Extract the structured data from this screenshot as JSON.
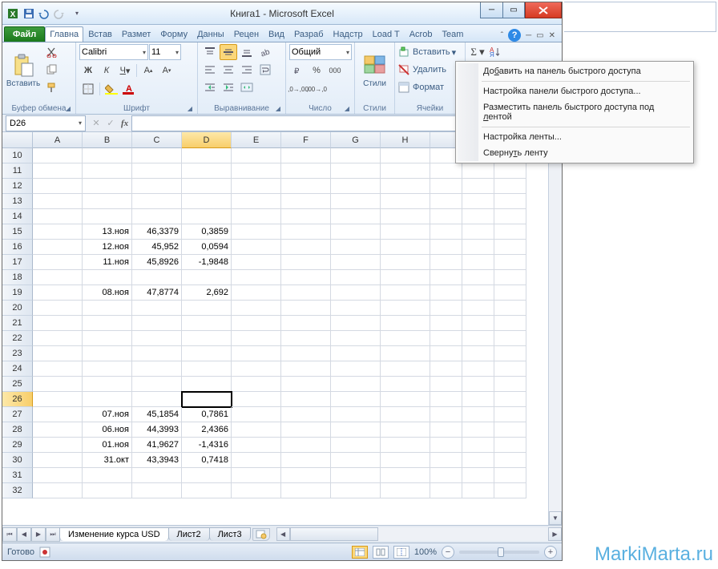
{
  "title": "Книга1 - Microsoft Excel",
  "tabs": {
    "file": "Файл",
    "list": [
      "Главна",
      "Встав",
      "Размет",
      "Форму",
      "Данны",
      "Рецен",
      "Вид",
      "Разраб",
      "Надстр",
      "Load T",
      "Acrob",
      "Team"
    ],
    "active_index": 0
  },
  "ribbon": {
    "clipboard": {
      "paste": "Вставить",
      "label": "Буфер обмена"
    },
    "font": {
      "name": "Calibri",
      "size": "11",
      "label": "Шрифт"
    },
    "alignment": {
      "label": "Выравнивание"
    },
    "number": {
      "format": "Общий",
      "label": "Число"
    },
    "styles": {
      "btn": "Стили",
      "label": "Стили"
    },
    "cells": {
      "insert": "Вставить",
      "delete": "Удалить",
      "format": "Формат",
      "label": "Ячейки"
    },
    "editing": {
      "label": ""
    }
  },
  "namebox": "D26",
  "columns": [
    "A",
    "B",
    "C",
    "D",
    "E",
    "F",
    "G",
    "H"
  ],
  "selected_col_index": 3,
  "selected_row": 26,
  "row_start": 10,
  "row_numbers": [
    10,
    11,
    12,
    13,
    14,
    15,
    16,
    17,
    18,
    19,
    20,
    21,
    22,
    23,
    24,
    25,
    26,
    27,
    28,
    29,
    30,
    31,
    32
  ],
  "cells": {
    "15": {
      "B": "13.ноя",
      "C": "46,3379",
      "D": "0,3859"
    },
    "16": {
      "B": "12.ноя",
      "C": "45,952",
      "D": "0,0594"
    },
    "17": {
      "B": "11.ноя",
      "C": "45,8926",
      "D": "-1,9848"
    },
    "19": {
      "B": "08.ноя",
      "C": "47,8774",
      "D": "2,692"
    },
    "27": {
      "B": "07.ноя",
      "C": "45,1854",
      "D": "0,7861"
    },
    "28": {
      "B": "06.ноя",
      "C": "44,3993",
      "D": "2,4366"
    },
    "29": {
      "B": "01.ноя",
      "C": "41,9627",
      "D": "-1,4316"
    },
    "30": {
      "B": "31.окт",
      "C": "43,3943",
      "D": "0,7418"
    }
  },
  "sheets": {
    "active": "Изменение курса USD",
    "others": [
      "Лист2",
      "Лист3"
    ]
  },
  "status": {
    "ready": "Готово",
    "zoom": "100%"
  },
  "context_menu": [
    "Добавить на панель быстрого доступа",
    "Настройка панели быстрого доступа...",
    "Разместить панель быстрого доступа под лентой",
    "Настройка ленты...",
    "Свернуть ленту"
  ],
  "watermark": "MarkiMarta.ru"
}
